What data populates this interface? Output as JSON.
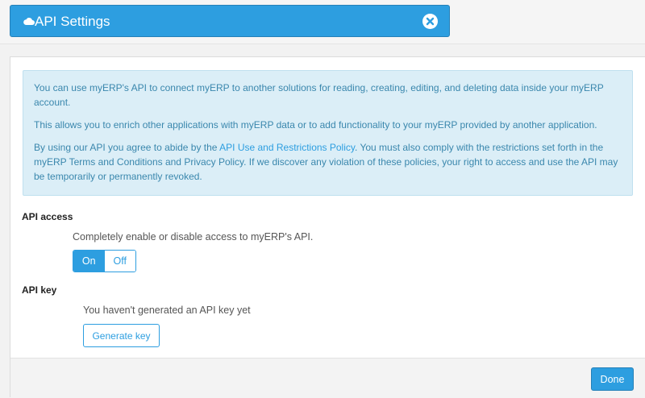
{
  "header": {
    "title": "API Settings",
    "icon": "cloud-icon",
    "close_icon": "close-icon"
  },
  "info": {
    "p1": "You can use myERP's API to connect myERP to another solutions for reading, creating, editing, and deleting data inside your myERP account.",
    "p2": "This allows you to enrich other applications with myERP data or to add functionality to your myERP provided by another application.",
    "p3_before": "By using our API you agree to abide by the ",
    "p3_link": "API Use and Restrictions Policy",
    "p3_after": ". You must also comply with the restrictions set forth in the myERP Terms and Conditions and Privacy Policy. If we discover any violation of these policies, your right to access and use the API may be temporarily or permanently revoked."
  },
  "api_access": {
    "label": "API access",
    "description": "Completely enable or disable access to myERP's API.",
    "on_label": "On",
    "off_label": "Off",
    "selected": "On"
  },
  "api_key": {
    "label": "API key",
    "status": "You haven't generated an API key yet",
    "generate_label": "Generate key"
  },
  "footer": {
    "done_label": "Done"
  },
  "colors": {
    "accent": "#2d9ee0",
    "info_bg": "#dbeef7",
    "info_text": "#3a87ad"
  }
}
